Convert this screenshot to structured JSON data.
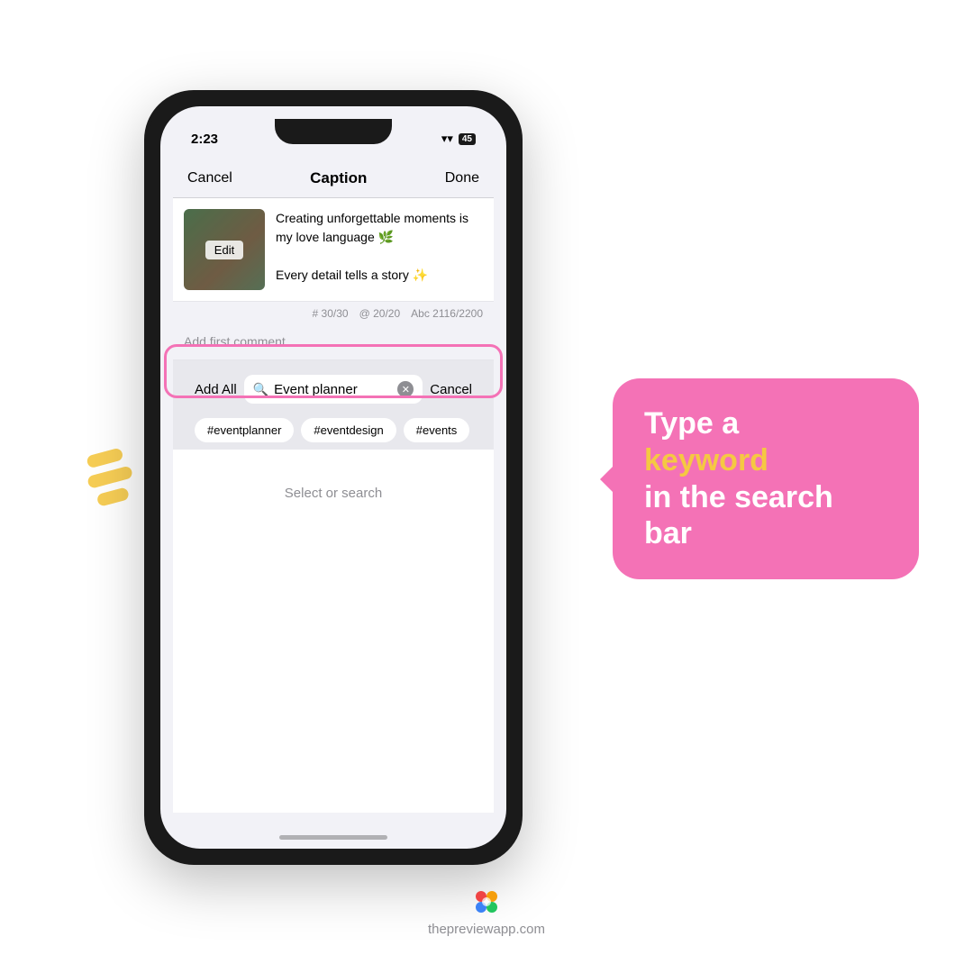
{
  "page": {
    "bg_color": "#ffffff"
  },
  "status_bar": {
    "time": "2:23",
    "wifi_icon": "wifi",
    "battery_label": "45"
  },
  "nav": {
    "cancel_label": "Cancel",
    "title": "Caption",
    "done_label": "Done"
  },
  "post": {
    "caption_line1": "Creating unforgettable moments is my love language 🌿",
    "caption_line2": "Every detail tells a story ✨",
    "edit_label": "Edit"
  },
  "stats": {
    "hashtags": "# 30/30",
    "mentions": "@ 20/20",
    "chars": "Abc 2116/2200"
  },
  "comment": {
    "placeholder": "Add first comment"
  },
  "search_row": {
    "add_all_label": "Add All",
    "search_value": "Event planner",
    "cancel_label": "Cancel"
  },
  "chips": {
    "items": [
      "#eventplanner",
      "#eventdesign",
      "#events"
    ]
  },
  "select_search": {
    "label": "Select or search"
  },
  "speech_bubble": {
    "line1": "Type  a",
    "line2_highlight": "keyword",
    "line3": "in the search",
    "line4": "bar"
  },
  "footer": {
    "url": "thepreviewapp.com"
  },
  "dashes": {
    "count": 3
  }
}
